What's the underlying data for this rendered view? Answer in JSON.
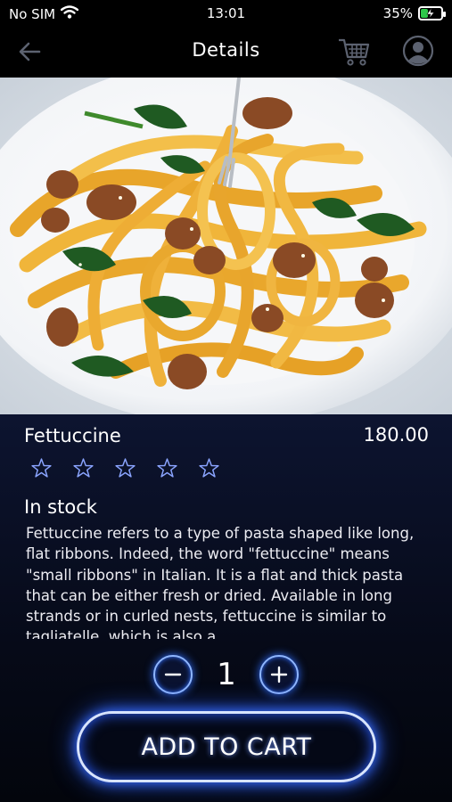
{
  "status_bar": {
    "carrier": "No SIM",
    "time": "13:01",
    "battery_percent": "35%",
    "battery_level": 0.35,
    "wifi_icon": "wifi-icon",
    "battery_icon": "battery-charging-icon"
  },
  "nav": {
    "title": "Details",
    "back_icon": "back-arrow-icon",
    "cart_icon": "cart-icon",
    "profile_icon": "profile-icon"
  },
  "product": {
    "image": "pasta-photo",
    "name": "Fettuccine",
    "price": "180.00",
    "rating": 0,
    "rating_max": 5,
    "stock": "In stock",
    "description": "Fettuccine refers to a type of pasta shaped like long, flat ribbons. Indeed, the word \"fettuccine\" means \"small ribbons\" in Italian. It is a flat and thick pasta that can be either fresh or dried. Available in long strands or in curled nests, fettuccine is similar to tagliatelle, which is also a"
  },
  "quantity": {
    "value": "1",
    "minus_icon": "minus-icon",
    "plus_icon": "plus-icon"
  },
  "actions": {
    "add_to_cart": "ADD TO CART"
  },
  "colors": {
    "accent_glow": "#2f6dff",
    "star_outline": "#8aa4ff",
    "battery_green": "#2ec84a"
  }
}
